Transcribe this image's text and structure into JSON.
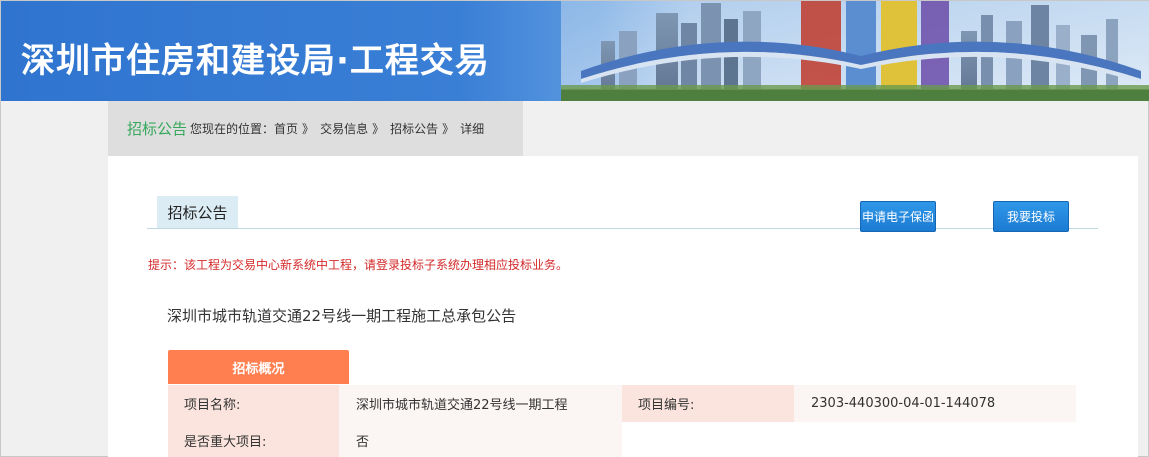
{
  "header": {
    "title": "深圳市住房和建设局·工程交易"
  },
  "breadcrumb": {
    "section": "招标公告",
    "prefix": "您现在的位置：",
    "items": [
      "首页",
      "交易信息",
      "招标公告"
    ],
    "separator": "》",
    "current": "详细"
  },
  "tab": {
    "label": "招标公告"
  },
  "actions": {
    "guarantee_label": "申请电子保函",
    "bid_label": "我要投标"
  },
  "tip": "提示：该工程为交易中心新系统中工程，请登录投标子系统办理相应投标业务。",
  "notice_title": "深圳市城市轨道交通22号线一期工程施工总承包公告",
  "overview": {
    "heading": "招标概况",
    "rows": [
      {
        "label1": "项目名称:",
        "value1": "深圳市城市轨道交通22号线一期工程",
        "label2": "项目编号:",
        "value2": "2303-440300-04-01-144078"
      },
      {
        "label1": "是否重大项目:",
        "value1": "否"
      }
    ]
  },
  "colors": {
    "banner_blue": "#2f74cf",
    "crumb_green": "#35a85b",
    "tip_red": "#d42a2a",
    "section_orange": "#ff7f50",
    "button_blue": "#1c7bd3"
  }
}
